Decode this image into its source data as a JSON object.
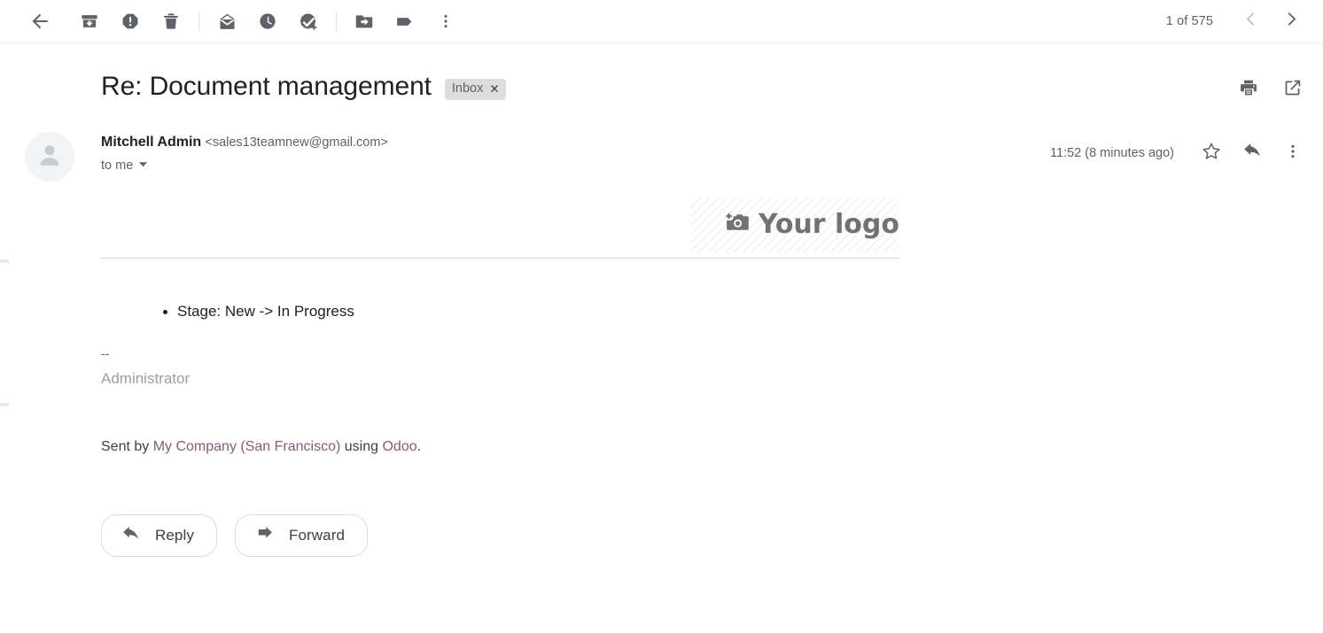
{
  "toolbar": {
    "back": {
      "label": "Back to Inbox",
      "icon": "arrow-left-icon"
    },
    "actions": [
      {
        "name": "archive",
        "label": "Archive",
        "icon": "archive-icon"
      },
      {
        "name": "report-spam",
        "label": "Report spam",
        "icon": "report-spam-icon"
      },
      {
        "name": "delete",
        "label": "Delete",
        "icon": "trash-icon"
      },
      {
        "name": "mark-unread",
        "label": "Mark as unread",
        "icon": "mail-unread-icon"
      },
      {
        "name": "snooze",
        "label": "Snooze",
        "icon": "clock-icon"
      },
      {
        "name": "add-to-tasks",
        "label": "Add to tasks",
        "icon": "task-add-icon"
      },
      {
        "name": "move-to",
        "label": "Move to",
        "icon": "folder-move-icon"
      },
      {
        "name": "labels",
        "label": "Labels",
        "icon": "label-tag-icon"
      },
      {
        "name": "more",
        "label": "More",
        "icon": "more-vertical-icon"
      }
    ],
    "pager": {
      "count_text": "1 of 575",
      "prev_label": "Older",
      "next_label": "Newer",
      "prev_icon": "chevron-left-icon",
      "next_icon": "chevron-right-icon"
    }
  },
  "message": {
    "subject": "Re: Document management",
    "label_chip": {
      "text": "Inbox",
      "remove": "✕"
    },
    "header_actions": [
      {
        "name": "print",
        "label": "Print all",
        "icon": "print-icon"
      },
      {
        "name": "open-new-window",
        "label": "Open in new window",
        "icon": "open-external-icon"
      }
    ],
    "sender": {
      "name": "Mitchell Admin",
      "email": "<sales13teamnew@gmail.com>",
      "recipient": "to me",
      "recipient_caret": "▾",
      "avatar_icon": "person-avatar-icon"
    },
    "timestamp": "11:52 (8 minutes ago)",
    "message_actions": [
      {
        "name": "star",
        "label": "Star",
        "icon": "star-outline-icon"
      },
      {
        "name": "reply",
        "label": "Reply",
        "icon": "reply-arrow-icon"
      },
      {
        "name": "more-options",
        "label": "More options",
        "icon": "more-vertical-icon"
      }
    ],
    "body": {
      "logo_placeholder": {
        "text": "Your logo",
        "icon": "camera-add-icon"
      },
      "bullets": [
        "Stage: New -> In Progress"
      ],
      "signature_separator": "--",
      "signature_name": "Administrator",
      "footer": {
        "prefix": "Sent by ",
        "company_link": "My Company (San Francisco)",
        "middle": " using ",
        "product_link": "Odoo",
        "suffix": "."
      }
    },
    "footer_buttons": [
      {
        "name": "reply",
        "label": "Reply",
        "icon": "reply-arrow-icon"
      },
      {
        "name": "forward",
        "label": "Forward",
        "icon": "forward-arrow-icon"
      }
    ]
  },
  "colors": {
    "icon_grey": "#5f6368",
    "text_primary": "#202124",
    "text_secondary": "#5f6368",
    "link_purple": "#875a7b",
    "chip_bg": "#ddddde",
    "border": "#dadce0"
  }
}
